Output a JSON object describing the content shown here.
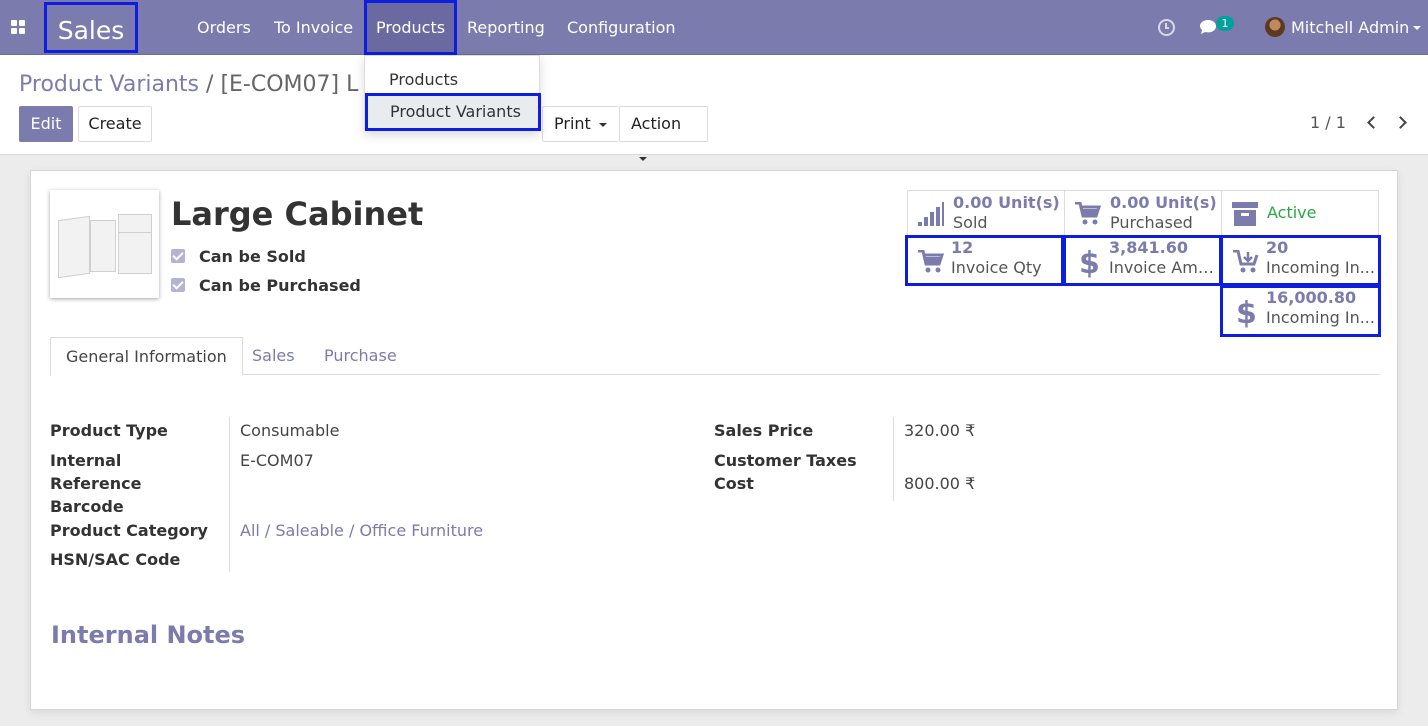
{
  "navbar": {
    "brand": "Sales",
    "menus": [
      "Orders",
      "To Invoice",
      "Products",
      "Reporting",
      "Configuration"
    ],
    "active_menu": "Products",
    "chat_badge": "1",
    "user": "Mitchell Admin"
  },
  "dropdown": {
    "items": [
      "Products",
      "Product Variants"
    ],
    "selected": "Product Variants"
  },
  "breadcrumb": {
    "parent": "Product Variants",
    "separator": "/",
    "current": "[E-COM07] L"
  },
  "buttons": {
    "edit": "Edit",
    "create": "Create",
    "print": "Print",
    "action": "Action"
  },
  "pager": "1 / 1",
  "product": {
    "name": "Large Cabinet",
    "can_be_sold": "Can be Sold",
    "can_be_purchased": "Can be Purchased"
  },
  "stats": {
    "sold": {
      "value": "0.00",
      "unit": "Unit(s)",
      "label": "Sold"
    },
    "purchased": {
      "value": "0.00",
      "unit": "Unit(s)",
      "label": "Purchased"
    },
    "active": {
      "label": "Active"
    },
    "invoice_qty": {
      "value": "12",
      "label": "Invoice Qty"
    },
    "invoice_amount": {
      "value": "3,841.60",
      "label": "Invoice Amo..."
    },
    "incoming_qty": {
      "value": "20",
      "label": "Incoming In..."
    },
    "incoming_amount": {
      "value": "16,000.80",
      "label": "Incoming In..."
    }
  },
  "tabs": [
    "General Information",
    "Sales",
    "Purchase"
  ],
  "fields": {
    "product_type": {
      "label": "Product Type",
      "value": "Consumable"
    },
    "internal_reference": {
      "label1": "Internal",
      "label2": "Reference",
      "value": "E-COM07"
    },
    "barcode": {
      "label": "Barcode",
      "value": ""
    },
    "product_category": {
      "label": "Product Category",
      "value": "All / Saleable / Office Furniture"
    },
    "hsn": {
      "label": "HSN/SAC Code",
      "value": ""
    },
    "sales_price": {
      "label": "Sales Price",
      "value": "320.00 ₹"
    },
    "customer_taxes": {
      "label": "Customer Taxes",
      "value": ""
    },
    "cost": {
      "label": "Cost",
      "value": "800.00 ₹"
    }
  },
  "internal_notes": "Internal Notes",
  "colors": {
    "brand": "#7c7bad",
    "highlight": "#0d1ee0",
    "active_green": "#28a745",
    "badge": "#00a09d"
  }
}
